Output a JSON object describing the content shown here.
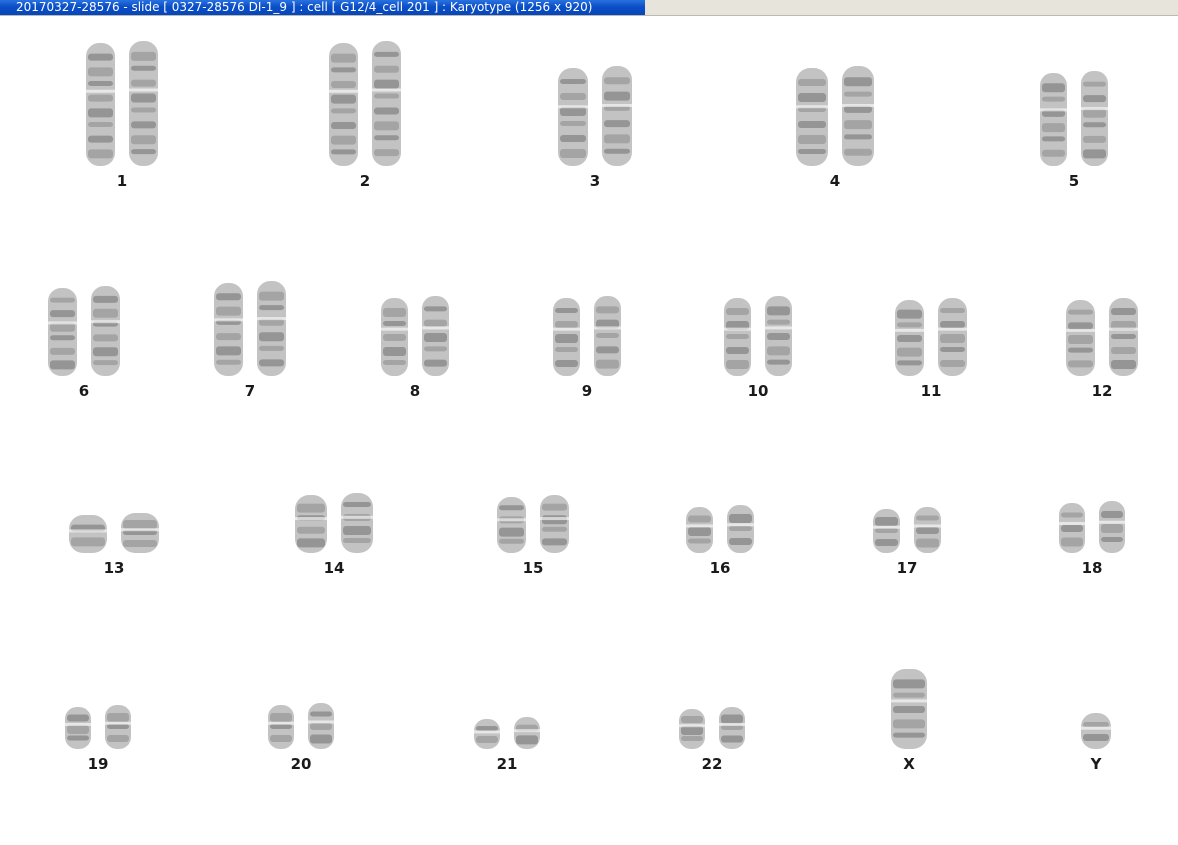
{
  "window": {
    "title": "20170327-28576 - slide [ 0327-28576 DI-1_9 ] : cell [ G12/4_cell 201 ] : Karyotype  (1256 x 920)"
  },
  "karyotype": {
    "pairs": [
      {
        "label": "1"
      },
      {
        "label": "2"
      },
      {
        "label": "3"
      },
      {
        "label": "4"
      },
      {
        "label": "5"
      },
      {
        "label": "6"
      },
      {
        "label": "7"
      },
      {
        "label": "8"
      },
      {
        "label": "9"
      },
      {
        "label": "10"
      },
      {
        "label": "11"
      },
      {
        "label": "12"
      },
      {
        "label": "13"
      },
      {
        "label": "14"
      },
      {
        "label": "15"
      },
      {
        "label": "16"
      },
      {
        "label": "17"
      },
      {
        "label": "18"
      },
      {
        "label": "19"
      },
      {
        "label": "20"
      },
      {
        "label": "21"
      },
      {
        "label": "22"
      },
      {
        "label": "X"
      },
      {
        "label": "Y"
      }
    ]
  }
}
